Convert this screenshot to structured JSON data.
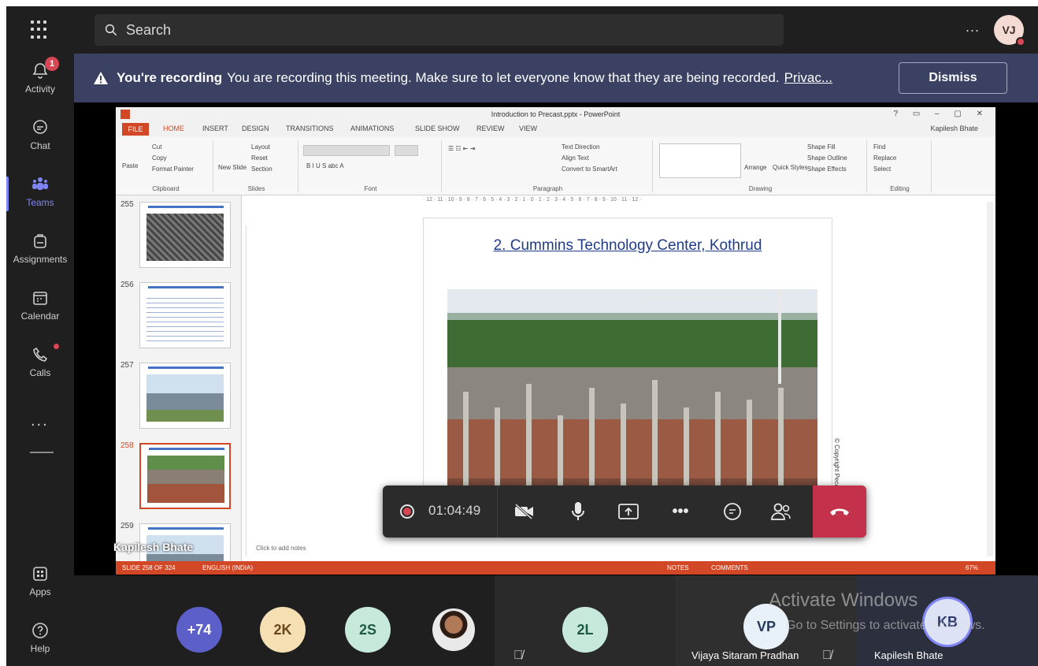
{
  "rail": {
    "items": [
      {
        "label": "Activity",
        "icon": "bell-icon",
        "badge": "1"
      },
      {
        "label": "Chat",
        "icon": "chat-icon"
      },
      {
        "label": "Teams",
        "icon": "teams-icon",
        "active": true
      },
      {
        "label": "Assignments",
        "icon": "assignments-icon"
      },
      {
        "label": "Calendar",
        "icon": "calendar-icon"
      },
      {
        "label": "Calls",
        "icon": "phone-icon",
        "dot": true
      },
      {
        "label": "Apps",
        "icon": "apps-icon"
      },
      {
        "label": "Help",
        "icon": "help-icon"
      }
    ],
    "more": "..."
  },
  "topbar": {
    "search_placeholder": "Search",
    "more": "...",
    "avatar_initials": "VJ"
  },
  "banner": {
    "strong": "You're recording",
    "message": "You are recording this meeting. Make sure to let everyone know that they are being recorded.",
    "link": "Privac...",
    "dismiss": "Dismiss"
  },
  "ppt": {
    "window_title": "Introduction to Precast.pptx - PowerPoint",
    "tabs": [
      "FILE",
      "HOME",
      "INSERT",
      "DESIGN",
      "TRANSITIONS",
      "ANIMATIONS",
      "SLIDE SHOW",
      "REVIEW",
      "VIEW"
    ],
    "user": "Kapilesh Bhate",
    "ribbon": {
      "clipboard": {
        "label": "Clipboard",
        "paste": "Paste",
        "cut": "Cut",
        "copy": "Copy",
        "painter": "Format Painter"
      },
      "slides": {
        "label": "Slides",
        "new_slide": "New Slide",
        "layout": "Layout",
        "reset": "Reset",
        "section": "Section"
      },
      "font": {
        "label": "Font"
      },
      "paragraph": {
        "label": "Paragraph",
        "text_direction": "Text Direction",
        "align_text": "Align Text",
        "smartart": "Convert to SmartArt"
      },
      "drawing": {
        "label": "Drawing",
        "arrange": "Arrange",
        "quick_styles": "Quick Styles",
        "shape_fill": "Shape Fill",
        "shape_outline": "Shape Outline",
        "shape_effects": "Shape Effects"
      },
      "editing": {
        "label": "Editing",
        "find": "Find",
        "replace": "Replace",
        "select": "Select"
      }
    },
    "ruler": "· 12 · 11 · 10 · 9 · 8 · 7 · 6 · 5 · 4 · 3 · 2 · 1 · 0 · 1 · 2 · 3 · 4 · 5 · 6 · 7 · 8 · 9 · 10 · 11 · 12 ·",
    "thumbnails": [
      {
        "num": "255"
      },
      {
        "num": "256"
      },
      {
        "num": "257"
      },
      {
        "num": "258",
        "selected": true
      },
      {
        "num": "259"
      }
    ],
    "slide_title": "2. Cummins Technology Center, Kothrud",
    "copyright": "© Copyright Pecast.com",
    "notes_placeholder": "Click to add notes",
    "status": {
      "slide": "SLIDE 258 OF 324",
      "language": "ENGLISH (INDIA)",
      "notes": "NOTES",
      "comments": "COMMENTS",
      "zoom": "67%"
    },
    "presenter": "Kapilesh Bhate"
  },
  "controls": {
    "timer": "01:04:49"
  },
  "participants": {
    "avatars": [
      {
        "label": "+74",
        "bg": "#5b5fc7",
        "fg": "#ffffff"
      },
      {
        "label": "2K",
        "bg": "#f5dfb3",
        "fg": "#6b4a1a"
      },
      {
        "label": "2S",
        "bg": "#c6e9dc",
        "fg": "#1f5a45"
      }
    ],
    "tile_2l": {
      "initials": "2L",
      "bg": "#c6e9dc"
    },
    "tile_vp": {
      "initials": "VP",
      "name": "Vijaya Sitaram Pradhan"
    },
    "tile_kb": {
      "initials": "KB",
      "name": "Kapilesh Bhate"
    }
  },
  "watermark": {
    "line1": "Activate Windows",
    "line2": "Go to Settings to activate Windows."
  }
}
